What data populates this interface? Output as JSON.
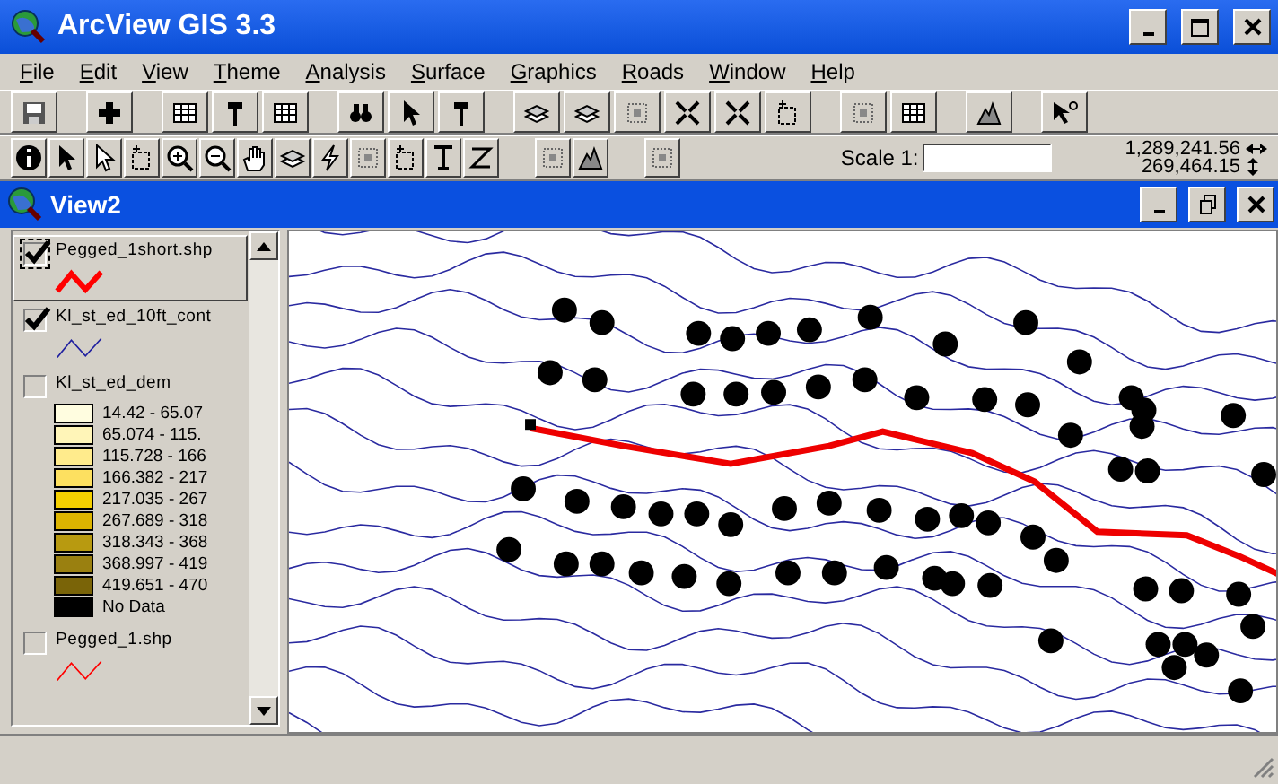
{
  "window": {
    "title": "ArcView GIS 3.3"
  },
  "menu": [
    "File",
    "Edit",
    "View",
    "Theme",
    "Analysis",
    "Surface",
    "Graphics",
    "Roads",
    "Window",
    "Help"
  ],
  "toolbar": {
    "scale_label": "Scale 1:",
    "x_coordinate": "1,289,241.56",
    "y_coordinate": "269,464.15"
  },
  "view": {
    "title": "View2",
    "themes": [
      {
        "kind": "line",
        "name": "Pegged_1short.shp",
        "checked": true,
        "selected": true,
        "color": "#ff0000"
      },
      {
        "kind": "line",
        "name": "Kl_st_ed_10ft_cont",
        "checked": true,
        "selected": false,
        "color": "#2020a0"
      },
      {
        "kind": "grid",
        "name": "Kl_st_ed_dem",
        "checked": false,
        "selected": false,
        "classes": [
          {
            "label": "14.42 - 65.07",
            "color": "#fffde0"
          },
          {
            "label": "65.074 - 115.",
            "color": "#fff5b8"
          },
          {
            "label": "115.728 - 166",
            "color": "#ffeb8c"
          },
          {
            "label": "166.382 - 217",
            "color": "#fde060"
          },
          {
            "label": "217.035 - 267",
            "color": "#f5d000"
          },
          {
            "label": "267.689 - 318",
            "color": "#dcb400"
          },
          {
            "label": "318.343 - 368",
            "color": "#b89a10"
          },
          {
            "label": "368.997 - 419",
            "color": "#9a8010"
          },
          {
            "label": "419.651 - 470",
            "color": "#7a6408"
          },
          {
            "label": "No Data",
            "color": "#000000"
          }
        ]
      },
      {
        "kind": "line",
        "name": "Pegged_1.shp",
        "checked": false,
        "selected": false,
        "color": "#ff0000"
      }
    ]
  }
}
